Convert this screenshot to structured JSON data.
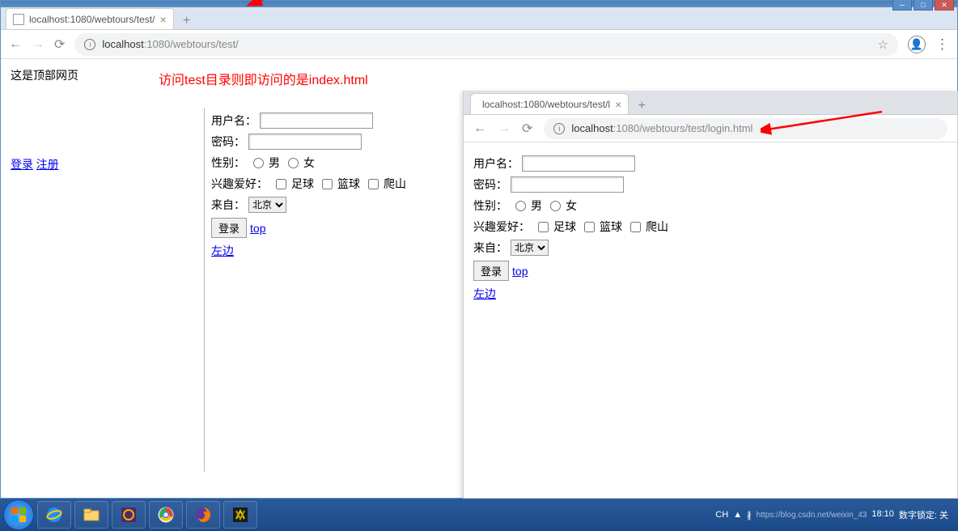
{
  "main_window": {
    "tab_title": "localhost:1080/webtours/test/",
    "url_host": "localhost",
    "url_port_path": ":1080/webtours/test/"
  },
  "page": {
    "top_text": "这是顶部网页",
    "annotation1": "访问test目录则即访问的是index.html",
    "left_links": {
      "login": "登录",
      "register": "注册"
    },
    "form": {
      "username_label": "用户名：",
      "password_label": "密码：",
      "gender_label": "性别：",
      "gender_male": "男",
      "gender_female": "女",
      "hobby_label": "兴趣爱好：",
      "hobby_football": "足球",
      "hobby_basketball": "篮球",
      "hobby_climbing": "爬山",
      "from_label": "来自：",
      "from_option": "北京",
      "submit": "登录",
      "top_link": "top",
      "left_link": "左边"
    }
  },
  "sub_window": {
    "tab_title": "localhost:1080/webtours/test/l",
    "url_host": "localhost",
    "url_port_path": ":1080/webtours/test/login.html"
  },
  "taskbar": {
    "lang": "CH",
    "status": "数字锁定: 关",
    "time": "18:10",
    "watermark": "https://blog.csdn.net/weixin_43"
  }
}
